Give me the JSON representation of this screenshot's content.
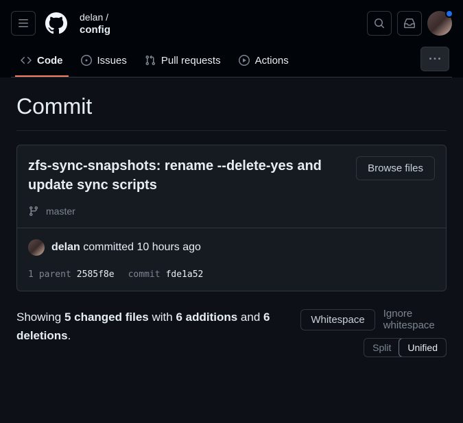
{
  "header": {
    "owner": "delan /",
    "repo": "config"
  },
  "tabs": {
    "code": "Code",
    "issues": "Issues",
    "pulls": "Pull requests",
    "actions": "Actions"
  },
  "page": {
    "title": "Commit"
  },
  "commit": {
    "title": "zfs-sync-snapshots: rename --delete-yes and update sync scripts",
    "browse": "Browse files",
    "branch": "master",
    "author": "delan",
    "action": "committed",
    "time": "10 hours ago",
    "parent_count": "1",
    "parent_label": "parent",
    "parent_sha": "2585f8e",
    "commit_label": "commit",
    "sha": "fde1a52"
  },
  "diff": {
    "showing": "Showing ",
    "files": "5 changed files",
    "with": " with ",
    "additions": "6 additions",
    "and": " and ",
    "deletions": "6 deletions",
    "period": ".",
    "whitespace_btn": "Whitespace",
    "ignore_ws": "Ignore whitespace",
    "split": "Split",
    "unified": "Unified"
  }
}
